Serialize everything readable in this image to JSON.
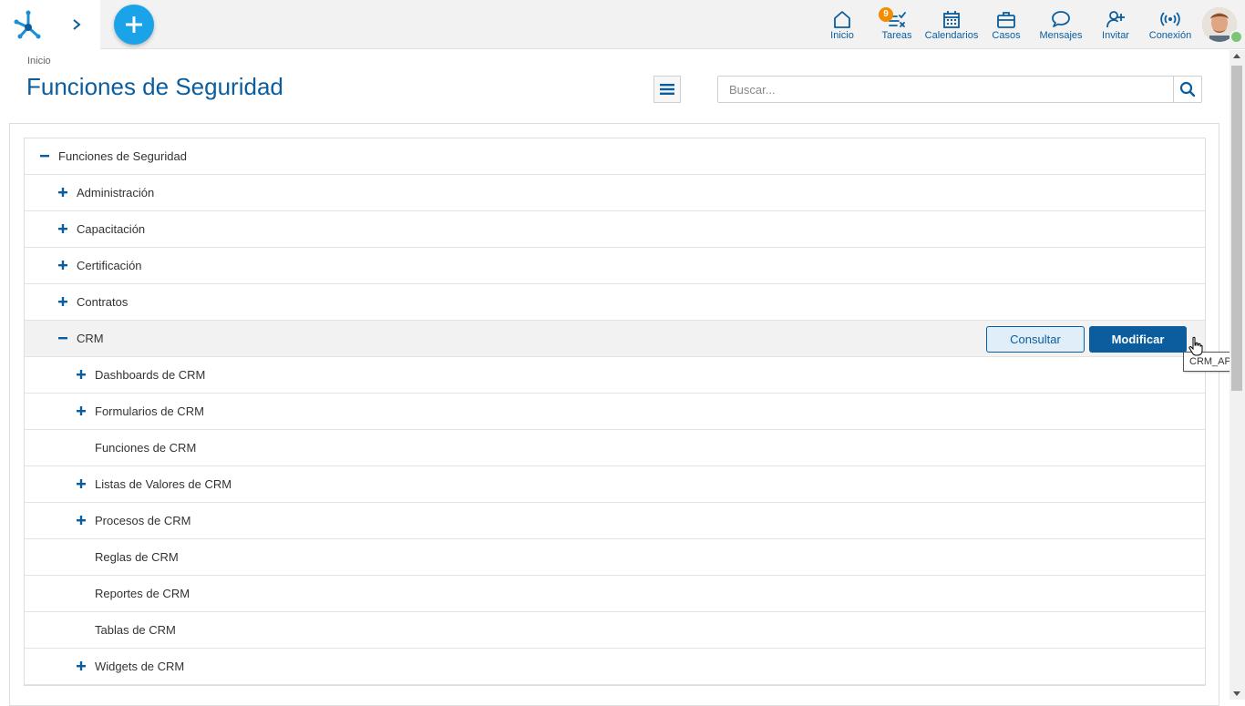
{
  "nav": [
    {
      "label": "Inicio",
      "icon": "home-icon"
    },
    {
      "label": "Tareas",
      "icon": "tasks-icon",
      "badge": "9"
    },
    {
      "label": "Calendarios",
      "icon": "calendar-icon"
    },
    {
      "label": "Casos",
      "icon": "briefcase-icon"
    },
    {
      "label": "Mensajes",
      "icon": "message-icon"
    },
    {
      "label": "Invitar",
      "icon": "invite-user-icon"
    },
    {
      "label": "Conexión",
      "icon": "connection-icon"
    }
  ],
  "breadcrumb": "Inicio",
  "page_title": "Funciones de Seguridad",
  "search": {
    "placeholder": "Buscar...",
    "value": ""
  },
  "tree": {
    "root": {
      "label": "Funciones de Seguridad",
      "state": "expanded"
    },
    "items": [
      {
        "label": "Administración",
        "state": "collapsed"
      },
      {
        "label": "Capacitación",
        "state": "collapsed"
      },
      {
        "label": "Certificación",
        "state": "collapsed"
      },
      {
        "label": "Contratos",
        "state": "collapsed"
      },
      {
        "label": "CRM",
        "state": "expanded",
        "selected": true
      },
      {
        "label": "Dashboards de CRM",
        "state": "collapsed"
      },
      {
        "label": "Formularios de CRM",
        "state": "collapsed"
      },
      {
        "label": "Funciones de CRM",
        "state": "leaf"
      },
      {
        "label": "Listas de Valores de CRM",
        "state": "collapsed"
      },
      {
        "label": "Procesos de CRM",
        "state": "collapsed"
      },
      {
        "label": "Reglas de CRM",
        "state": "leaf"
      },
      {
        "label": "Reportes de CRM",
        "state": "leaf"
      },
      {
        "label": "Tablas de CRM",
        "state": "leaf"
      },
      {
        "label": "Widgets de CRM",
        "state": "collapsed"
      }
    ]
  },
  "actions": {
    "consultar": "Consultar",
    "modificar": "Modificar"
  },
  "tooltip": "CRM_APP",
  "colors": {
    "primary": "#0b5d9e",
    "accent": "#1aa3e8",
    "badge": "#f28c00",
    "online": "#7cc576"
  }
}
